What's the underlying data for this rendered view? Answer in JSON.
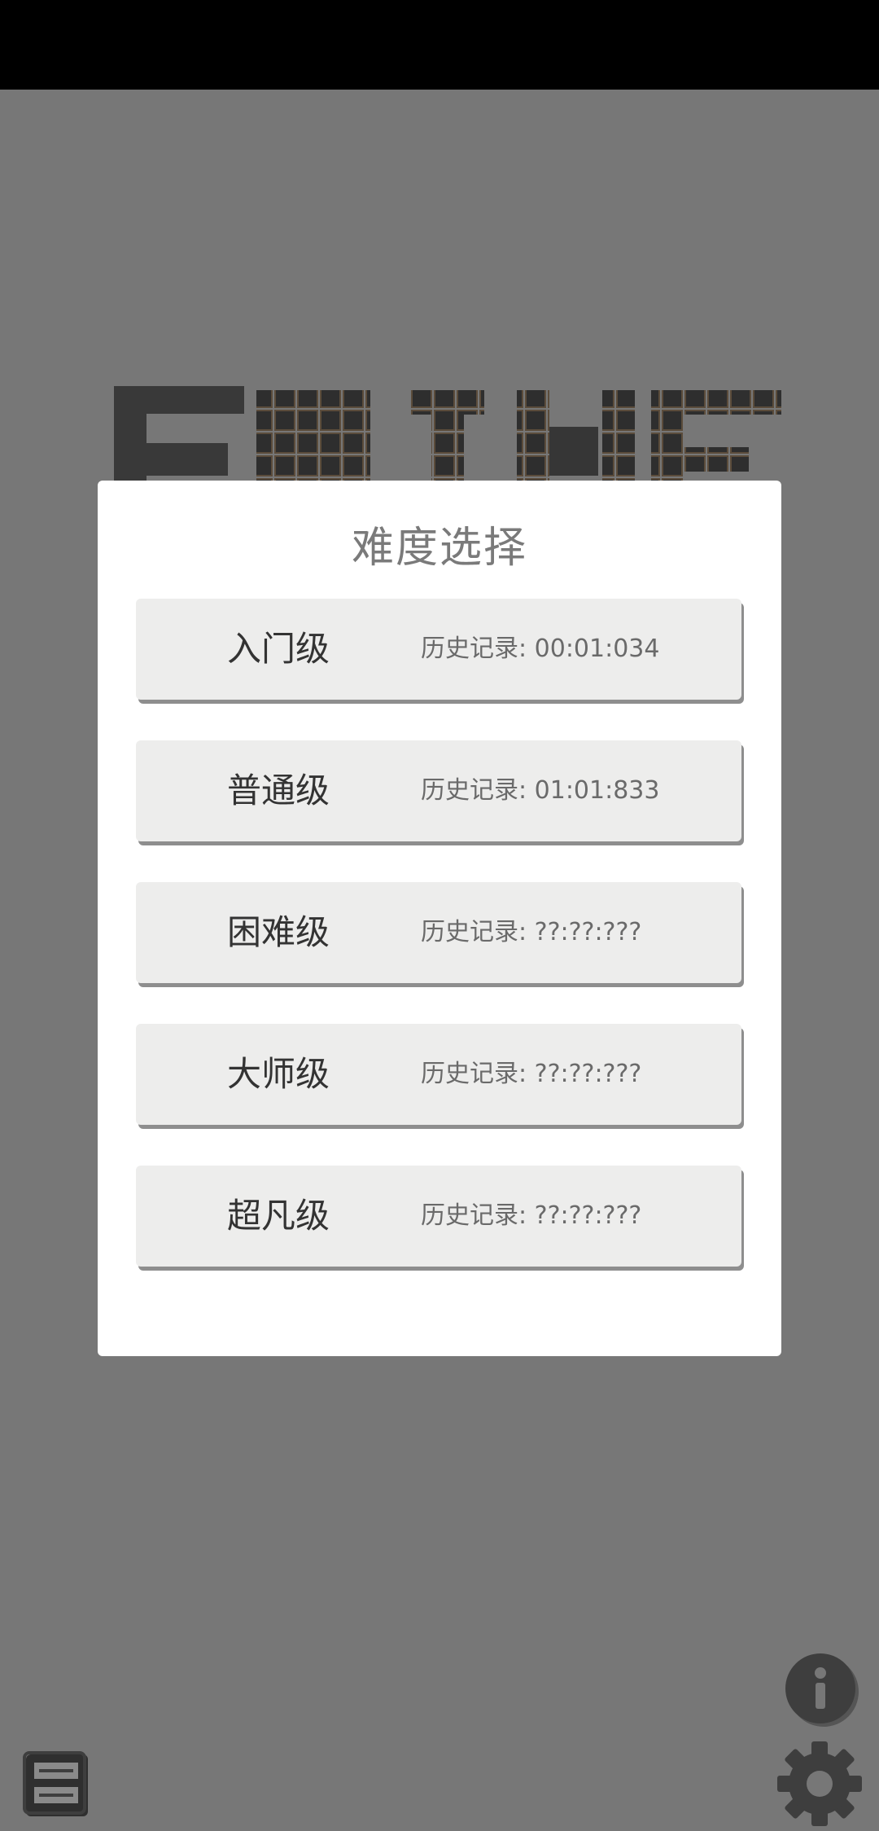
{
  "dialog": {
    "title": "难度选择",
    "levels": [
      {
        "name": "入门级",
        "record": "历史记录: 00:01:034"
      },
      {
        "name": "普通级",
        "record": "历史记录: 01:01:833"
      },
      {
        "name": "困难级",
        "record": "历史记录: ??:??:???"
      },
      {
        "name": "大师级",
        "record": "历史记录: ??:??:???"
      },
      {
        "name": "超凡级",
        "record": "历史记录: ??:??:???"
      }
    ]
  },
  "icons": {
    "info": "info-icon",
    "settings": "gear-icon",
    "archive": "archive-icon"
  },
  "colors": {
    "overlay": "#777777",
    "dialog_bg": "#ffffff",
    "button_bg": "#ededec",
    "title_text": "#7a7a7a",
    "icon_dark": "#3e3e3e"
  }
}
